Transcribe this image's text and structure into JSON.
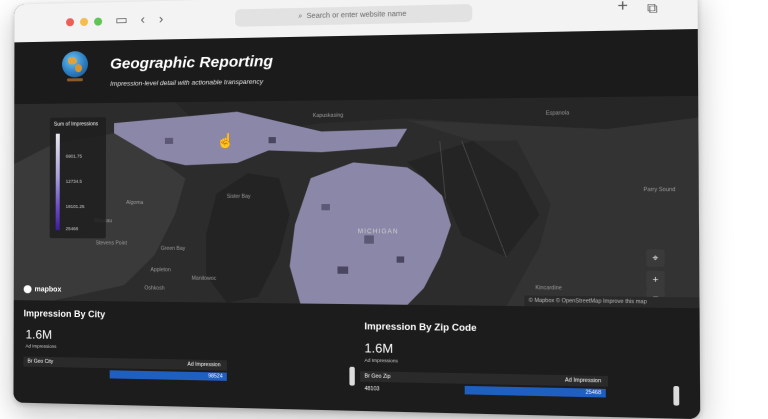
{
  "browser": {
    "address_placeholder": "Search or enter website name"
  },
  "header": {
    "title": "Geographic Reporting",
    "subtitle": "Impression-level detail with actionable transparency"
  },
  "map": {
    "legend_title": "Sum of Impressions",
    "legend_ticks": [
      "6901.75",
      "12734.5",
      "19101.25",
      "25468"
    ],
    "place_labels": [
      "Kapuskasing",
      "Espanola",
      "Parry Sound",
      "Algoma",
      "Green Bay",
      "Appleton",
      "Oshkosh",
      "Kincardine",
      "MICHIGAN",
      "Stevens Point",
      "Wausau",
      "Manitowoc",
      "Sister Bay"
    ],
    "mapbox_label": "mapbox",
    "attribution": "© Mapbox © OpenStreetMap  Improve this map",
    "controls": [
      "+",
      "−"
    ]
  },
  "city_panel": {
    "title": "Impression By City",
    "value": "1.6M",
    "value_label": "Ad Impressions",
    "col1": "Br Geo City",
    "col2": "Ad Impression",
    "bar_value": "98524"
  },
  "zip_panel": {
    "title": "Impression By Zip Code",
    "value": "1.6M",
    "value_label": "Ad Impressions",
    "col1": "Br Geo Zip",
    "col2": "Ad Impression",
    "row_zip": "48103",
    "bar_value": "25468"
  },
  "colors": {
    "accent_blue": "#1f5fbf",
    "map_fill": "#8b87a8"
  }
}
